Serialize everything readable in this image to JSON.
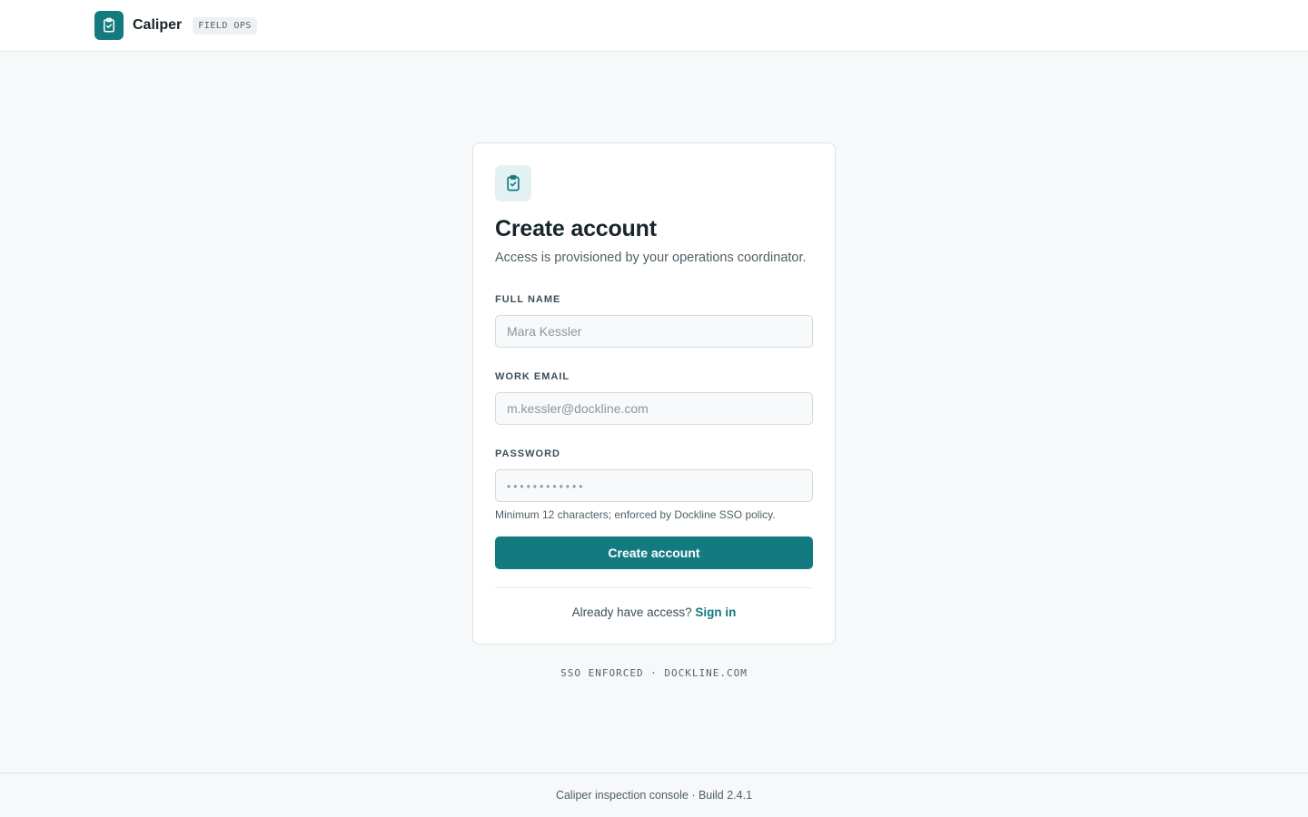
{
  "header": {
    "brand_name": "Caliper",
    "brand_badge": "FIELD OPS",
    "logo_icon": "clipboard-check-icon"
  },
  "colors": {
    "accent": "#137b80",
    "background": "#f6f8f9",
    "card": "#ffffff",
    "icon_tile": "#e3f1f2"
  },
  "form": {
    "icon": "clipboard-check-icon",
    "title": "Create account",
    "subtitle": "Access is provisioned by your operations coordinator.",
    "full_name": {
      "label": "FULL NAME",
      "placeholder": "Mara Kessler",
      "value": ""
    },
    "work_email": {
      "label": "WORK EMAIL",
      "placeholder": "m.kessler@dockline.com",
      "value": ""
    },
    "password": {
      "label": "PASSWORD",
      "placeholder": "••••••••••••",
      "value": ""
    },
    "password_hint": "Minimum 12 characters; enforced by Dockline SSO policy.",
    "submit_label": "Create account",
    "signin_prompt": "Already have access?",
    "signin_link": "Sign in"
  },
  "sso_note": "SSO ENFORCED · DOCKLINE.COM",
  "footer": {
    "text": "Caliper inspection console · Build 2.4.1"
  }
}
